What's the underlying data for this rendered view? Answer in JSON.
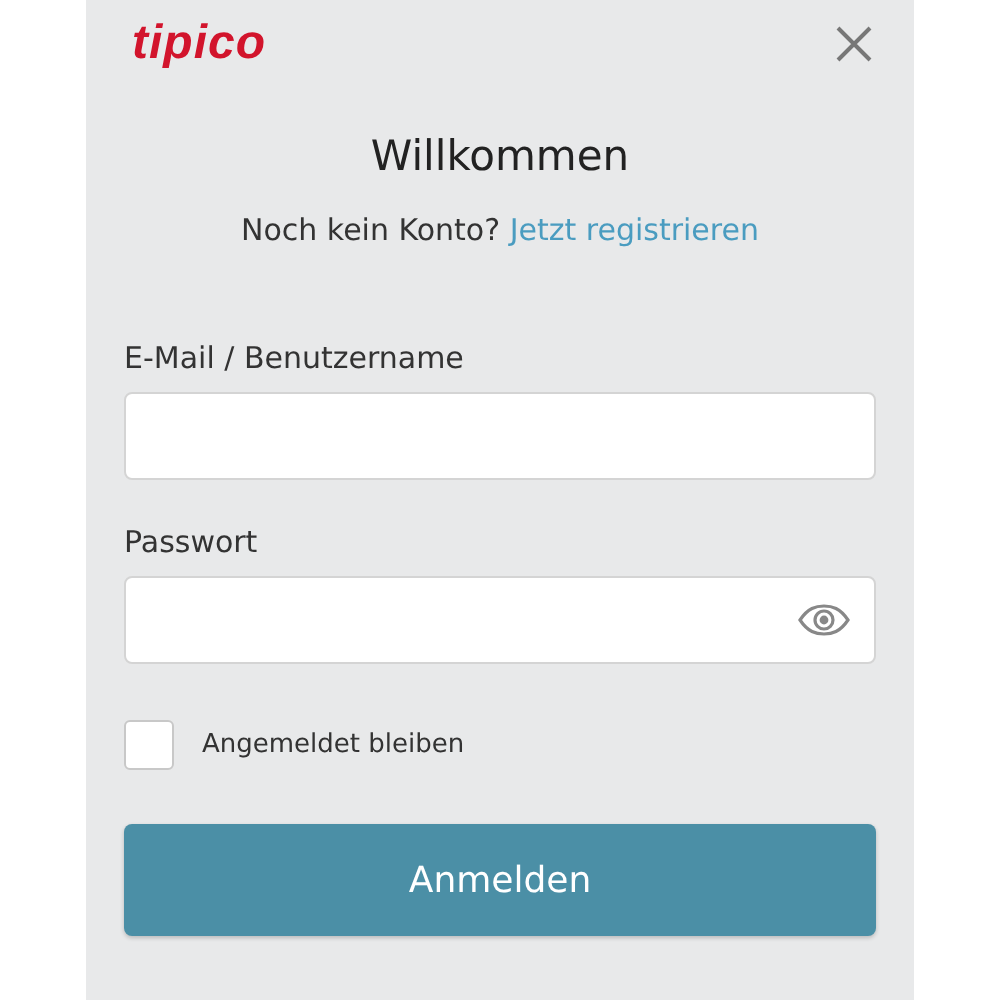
{
  "logo": "tipico",
  "title": "Willkommen",
  "signup": {
    "prompt": "Noch kein Konto?",
    "link": "Jetzt registrieren"
  },
  "fields": [
    {
      "label": "E-Mail / Benutzername",
      "kind": "text"
    },
    {
      "label": "Passwort",
      "kind": "password"
    }
  ],
  "remember": {
    "label": "Angemeldet bleiben",
    "checked": false
  },
  "submit": "Anmelden"
}
